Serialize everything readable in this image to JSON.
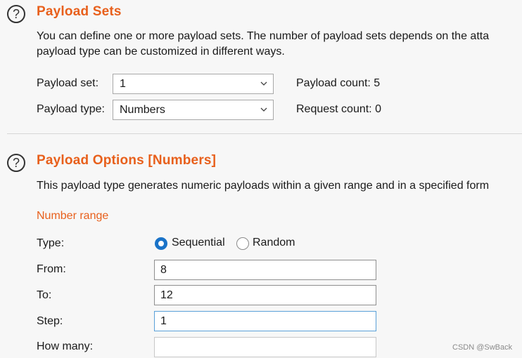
{
  "payload_sets": {
    "title": "Payload Sets",
    "description_line1": "You can define one or more payload sets. The number of payload sets depends on the atta",
    "description_line2": "payload type can be customized in different ways.",
    "set_label": "Payload set:",
    "set_value": "1",
    "type_label": "Payload type:",
    "type_value": "Numbers",
    "payload_count": "Payload count: 5",
    "request_count": "Request count: 0"
  },
  "payload_options": {
    "title": "Payload Options [Numbers]",
    "description": "This payload type generates numeric payloads within a given range and in a specified form",
    "number_range_heading": "Number range",
    "type_label": "Type:",
    "radio_sequential": "Sequential",
    "radio_random": "Random",
    "selected_type": "Sequential",
    "from_label": "From:",
    "from_value": "8",
    "to_label": "To:",
    "to_value": "12",
    "step_label": "Step:",
    "step_value": "1",
    "how_many_label": "How many:",
    "how_many_value": ""
  },
  "icons": {
    "help": "question-mark-circle-icon",
    "dropdown": "chevron-down-icon"
  },
  "help_glyph": "?",
  "watermark": "CSDN @SwBack",
  "colors": {
    "accent": "#e8601c",
    "radio_selected": "#1a73c8",
    "background": "#f7f7f7"
  }
}
